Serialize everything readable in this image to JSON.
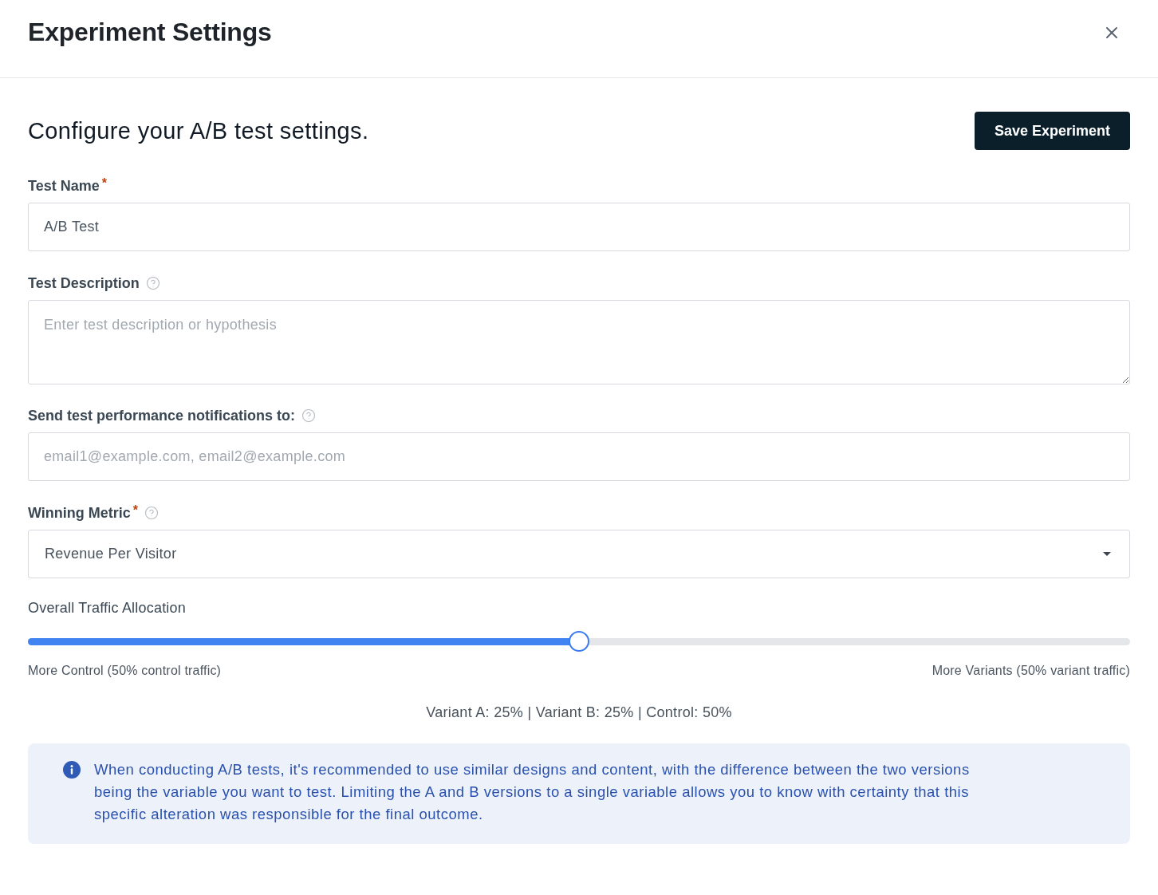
{
  "dialog": {
    "title": "Experiment Settings"
  },
  "intro": {
    "subtitle": "Configure your A/B test settings.",
    "save_button": "Save Experiment"
  },
  "fields": [
    {
      "kind": "text",
      "label": "Test Name",
      "required_mark": "*",
      "help": false,
      "value": "A/B Test"
    },
    {
      "kind": "textarea",
      "label": "Test Description",
      "help": true,
      "placeholder": "Enter test description or hypothesis"
    },
    {
      "kind": "text",
      "label": "Send test performance notifications to:",
      "help": true,
      "placeholder": "email1@example.com, email2@example.com"
    },
    {
      "kind": "select",
      "label": "Winning Metric",
      "required_mark": "*",
      "help": true,
      "value": "Revenue Per Visitor"
    }
  ],
  "traffic": {
    "label": "Overall Traffic Allocation",
    "level": 0.5,
    "min_label": "More Control (50% control traffic)",
    "max_label": "More Variants (50% variant traffic)",
    "summary": "Variant A: 25% | Variant B: 25% | Control: 50%"
  },
  "info": {
    "text": "When conducting A/B tests, it's recommended to use similar designs and content, with the difference between the two versions being the variable you want to test. Limiting the A and B versions to a single variable allows you to know with certainty that this specific alteration was responsible for the final outcome."
  }
}
